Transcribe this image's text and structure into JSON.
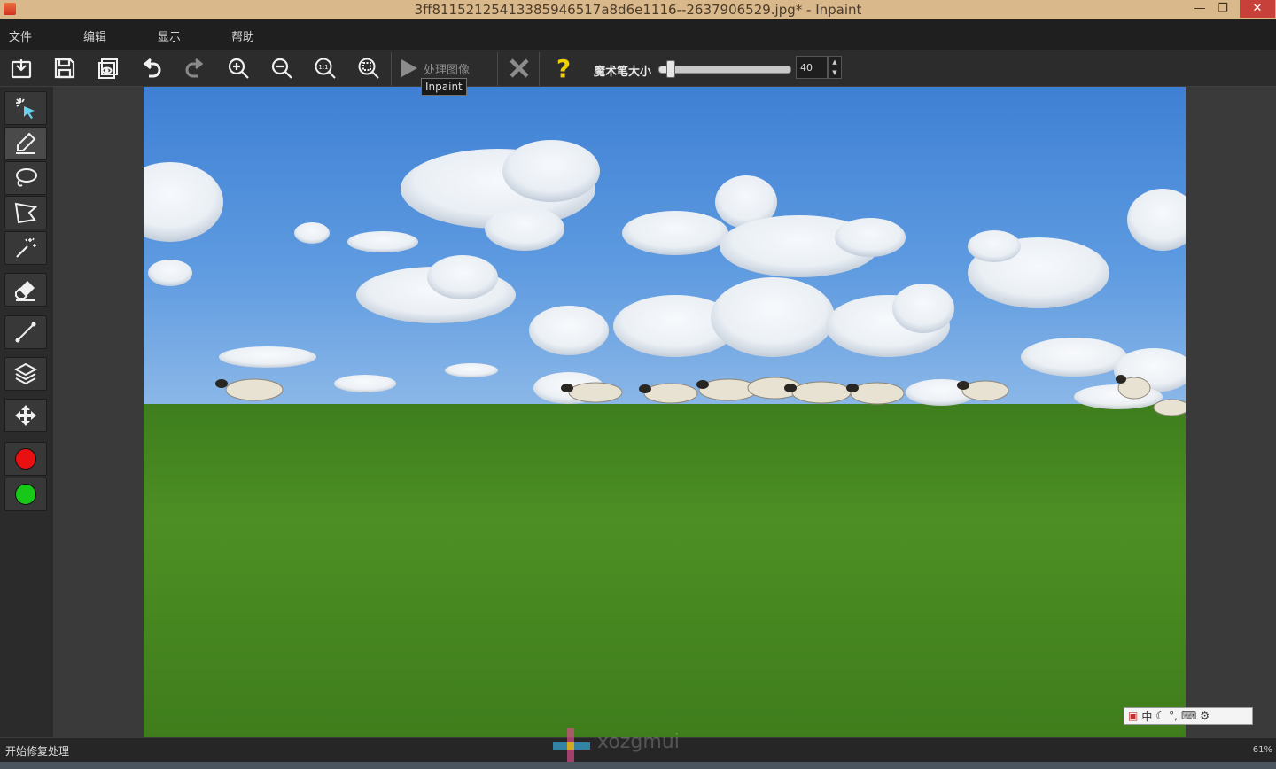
{
  "window": {
    "title": "3ff8115212541338594651​7a8d6e1116--2637906529.jpg* - Inpaint",
    "min_icon": "minimize-icon",
    "max_icon": "restore-icon",
    "close_icon": "close-icon"
  },
  "menu": {
    "file": "文件",
    "edit": "编辑",
    "view": "显示",
    "help": "帮助"
  },
  "toolbar": {
    "buttons": [
      "open-icon",
      "save-icon",
      "preview-icon",
      "undo-icon",
      "redo-icon",
      "zoom-in-icon",
      "zoom-out-icon",
      "actual-size-icon",
      "fit-icon"
    ],
    "process_label": "处理图像",
    "tooltip": "Inpaint",
    "cancel_icon": "cancel-icon",
    "help_icon": "help-icon",
    "brush_size_label": "魔术笔大小",
    "brush_size_value": "40",
    "brush_size_fraction": 0.08
  },
  "tools": [
    "select-icon",
    "marker-icon",
    "lasso-icon",
    "polygon-lasso-icon",
    "magic-wand-icon",
    "eraser-icon",
    "line-icon",
    "layers-icon",
    "move-icon",
    "red-marker",
    "green-marker"
  ],
  "colors": {
    "red_marker": "#e81010",
    "green_marker": "#18c818",
    "accent": "#f0d000"
  },
  "ime": {
    "lang": "中"
  },
  "status": {
    "text": "开始修复处理",
    "zoom": "61%"
  },
  "watermark": {
    "text": "xozgmui"
  }
}
